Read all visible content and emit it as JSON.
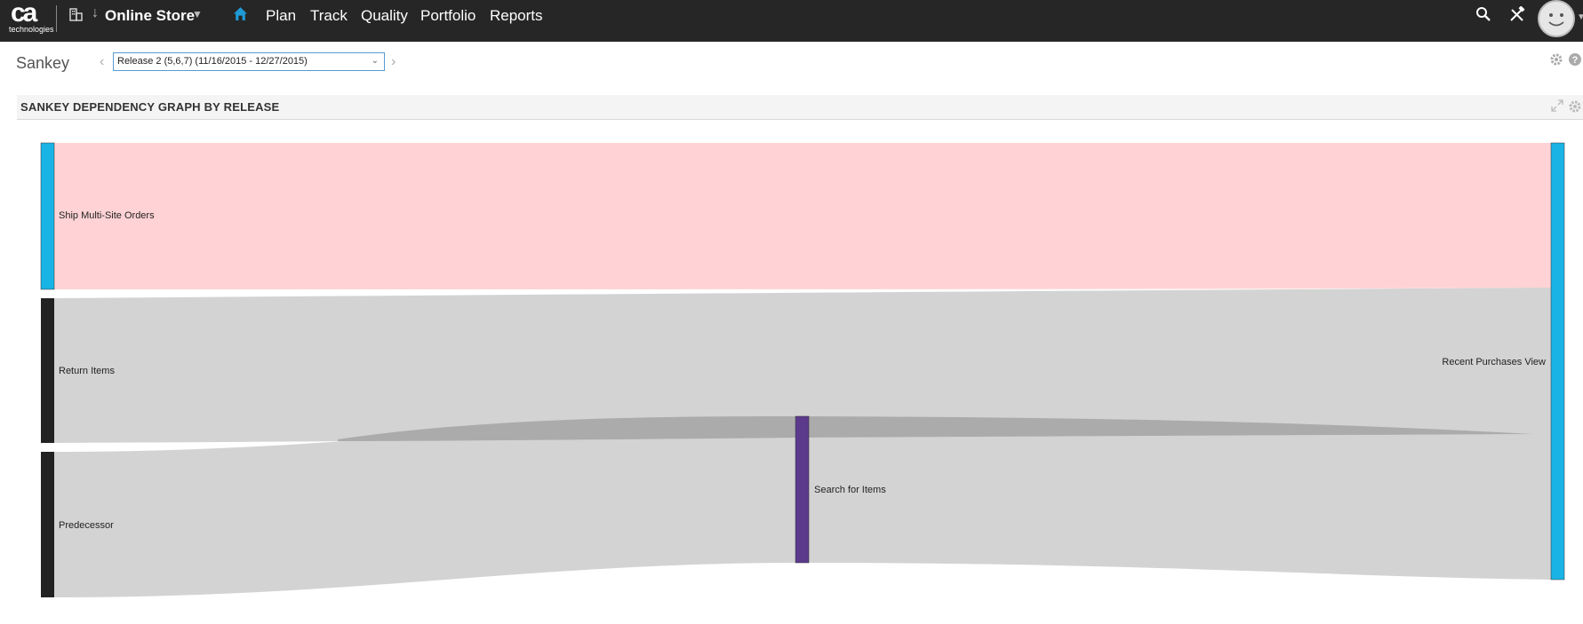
{
  "nav": {
    "logo_mark": "ca",
    "logo_sub": "technologies",
    "workspace": "Online Store",
    "items": [
      "Plan",
      "Track",
      "Quality",
      "Portfolio",
      "Reports"
    ],
    "icons": [
      "home-icon",
      "building-icon",
      "search-icon",
      "tools-icon",
      "user-avatar"
    ]
  },
  "page": {
    "title": "Sankey",
    "release_selected": "Release 2 (5,6,7) (11/16/2015 - 12/27/2015)"
  },
  "panel": {
    "title": "SANKEY DEPENDENCY GRAPH BY RELEASE"
  },
  "chart_data": {
    "type": "sankey",
    "nodes": [
      {
        "name": "Ship Multi-Site Orders",
        "color": "#1ab3e6",
        "column": 0
      },
      {
        "name": "Return Items",
        "color": "#222222",
        "column": 0
      },
      {
        "name": "Predecessor",
        "color": "#222222",
        "column": 0
      },
      {
        "name": "Search for Items",
        "color": "#5b3a8c",
        "column": 1
      },
      {
        "name": "Recent Purchases View",
        "color": "#1ab3e6",
        "column": 2
      }
    ],
    "links": [
      {
        "source": "Ship Multi-Site Orders",
        "target": "Recent Purchases View",
        "value": 1,
        "color": "#ffd3d5"
      },
      {
        "source": "Return Items",
        "target": "Recent Purchases View",
        "value": 1,
        "color": "#d3d3d3"
      },
      {
        "source": "Predecessor",
        "target": "Search for Items",
        "value": 1,
        "color": "#d3d3d3"
      },
      {
        "source": "Search for Items",
        "target": "Recent Purchases View",
        "value": 1,
        "color": "#d3d3d3"
      }
    ],
    "colors": {
      "highlight_link": "#ffd3d5",
      "link": "#d3d3d3",
      "crossing_link": "#ababab"
    }
  }
}
